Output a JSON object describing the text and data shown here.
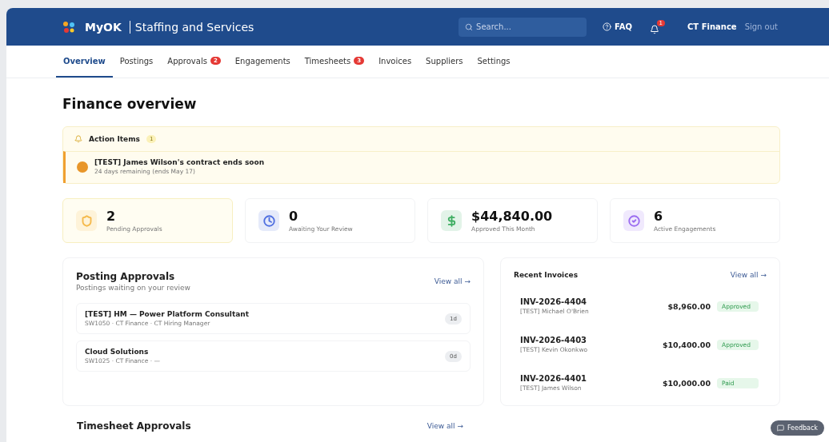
{
  "header": {
    "brand": "MyOK",
    "subtitle": "Staffing and Services",
    "search": {
      "placeholder": "Search..."
    },
    "faq": "FAQ",
    "notifications": "1",
    "user": "CT Finance",
    "sign_out": "Sign out"
  },
  "tabs": [
    {
      "label": "Overview",
      "selected": true
    },
    {
      "label": "Postings",
      "selected": false
    },
    {
      "label": "Approvals",
      "selected": false,
      "badge": "2"
    },
    {
      "label": "Engagements",
      "selected": false
    },
    {
      "label": "Timesheets",
      "selected": false,
      "badge": "3"
    },
    {
      "label": "Invoices",
      "selected": false
    },
    {
      "label": "Suppliers",
      "selected": false
    },
    {
      "label": "Settings",
      "selected": false
    }
  ],
  "page_title": "Finance overview",
  "action_items": {
    "title": "Action Items",
    "count": "1",
    "items": [
      {
        "title": "[TEST] James Wilson's contract ends soon",
        "detail": "24 days remaining (ends May 17)"
      }
    ]
  },
  "stats": [
    {
      "kind": "shield",
      "value": "2",
      "label": "Pending Approvals",
      "color": "#f5b94a"
    },
    {
      "kind": "clock",
      "value": "0",
      "label": "Awaiting Your Review",
      "color": "#4f6fe0"
    },
    {
      "kind": "dollar",
      "value": "$44,840.00",
      "label": "Approved This Month",
      "color": "#3fae62"
    },
    {
      "kind": "check",
      "value": "6",
      "label": "Active Engagements",
      "color": "#9b6cf0"
    }
  ],
  "posting_approvals": {
    "title": "Posting Approvals",
    "subtitle": "Postings waiting on your review",
    "view_all": "View all →",
    "rows": [
      {
        "title": "[TEST] HM — Power Platform Consultant",
        "meta": "SW1050 · CT Finance · CT Hiring Manager",
        "age": "1d"
      },
      {
        "title": "Cloud Solutions",
        "meta": "SW1025 · CT Finance · —",
        "age": "0d"
      }
    ]
  },
  "timesheet_approvals": {
    "title": "Timesheet Approvals",
    "view_all": "View all →"
  },
  "recent_invoices": {
    "title": "Recent Invoices",
    "view_all": "View all →",
    "rows": [
      {
        "number": "INV-2026-4404",
        "name": "[TEST] Michael O'Brien",
        "amount": "$8,960.00",
        "status": "Approved"
      },
      {
        "number": "INV-2026-4403",
        "name": "[TEST] Kevin Okonkwo",
        "amount": "$10,400.00",
        "status": "Approved"
      },
      {
        "number": "INV-2026-4401",
        "name": "[TEST] James Wilson",
        "amount": "$10,000.00",
        "status": "Paid"
      }
    ]
  },
  "feedback": "Feedback"
}
